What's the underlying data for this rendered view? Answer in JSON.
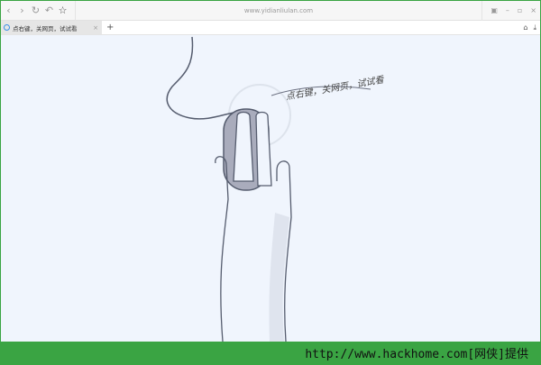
{
  "toolbar": {
    "back": "‹",
    "forward": "›",
    "reload": "↻",
    "undo": "↶",
    "star": "☆",
    "url": "www.yidianliulan.com"
  },
  "window_controls": {
    "menu": "▣",
    "minimize": "–",
    "maximize": "▫",
    "close": "×"
  },
  "tab": {
    "title": "点右键，关网页，试试看",
    "close": "×",
    "new_tab": "+"
  },
  "right_icons": {
    "home": "⌂",
    "download": "⤓"
  },
  "content": {
    "hint": "点右键，关网页，试试看"
  },
  "footer": {
    "watermark": "http://www.hackhome.com[网侠]提供"
  },
  "colors": {
    "border": "#3aa443",
    "page": "#f0f5fd"
  }
}
